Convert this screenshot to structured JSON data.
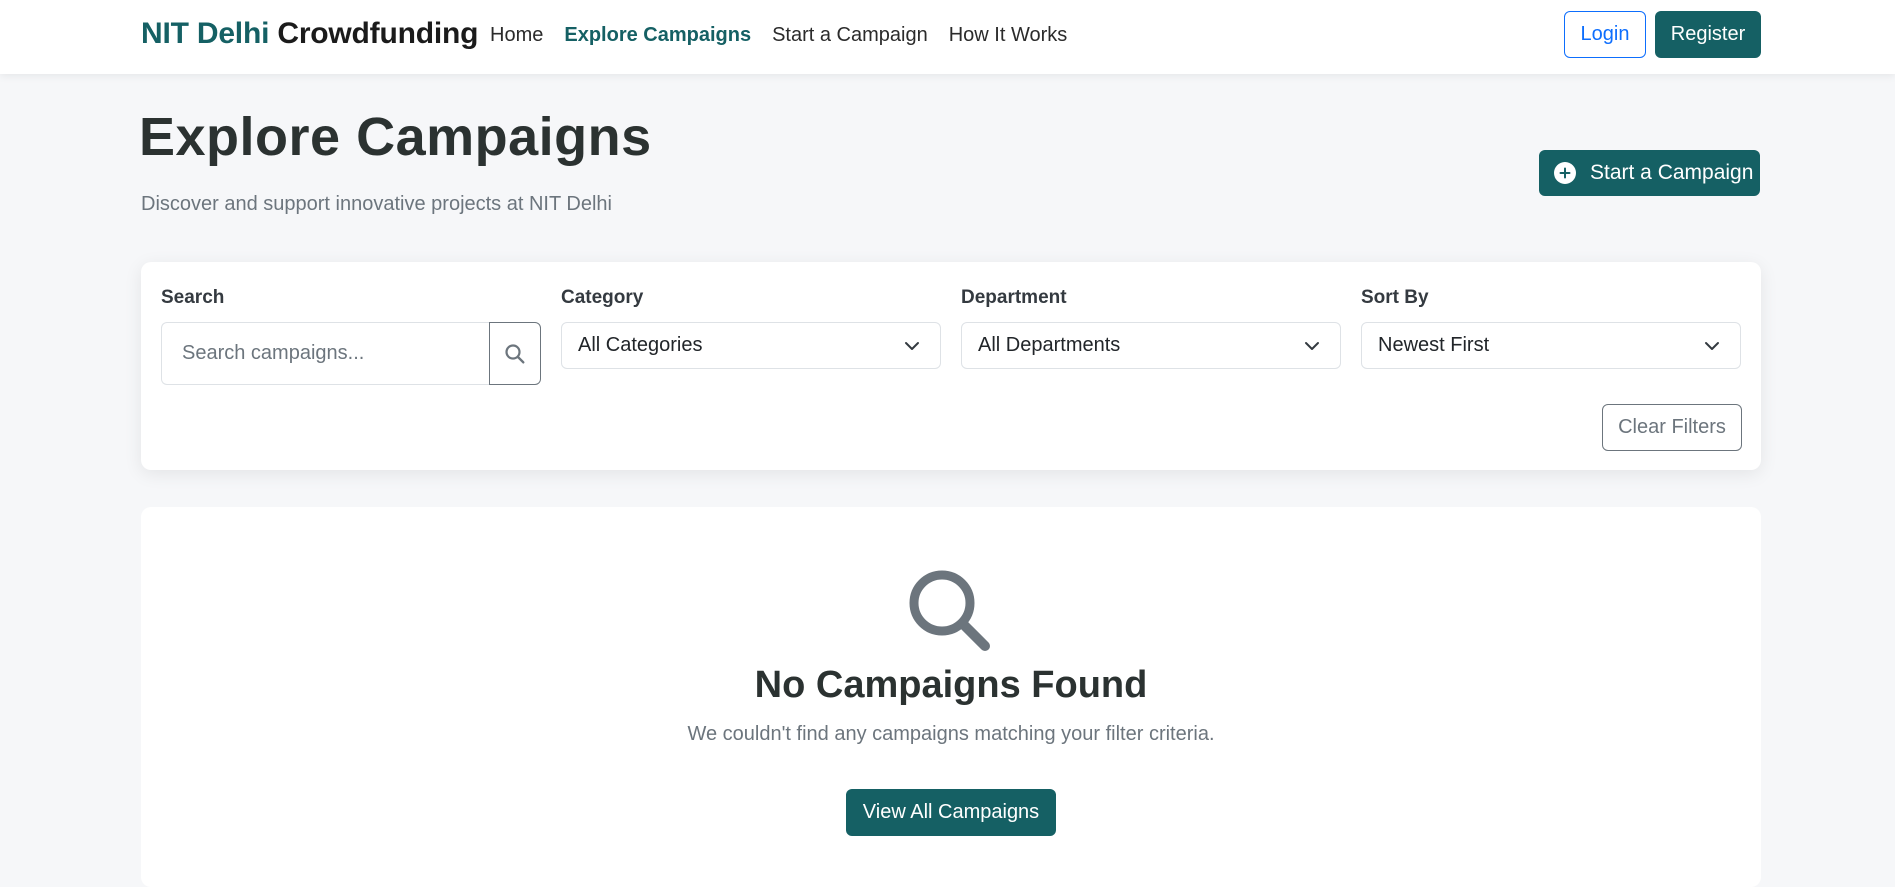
{
  "navbar": {
    "brand_accent": "NIT Delhi",
    "brand_rest": "Crowdfunding",
    "links": [
      {
        "label": "Home",
        "active": false
      },
      {
        "label": "Explore Campaigns",
        "active": true
      },
      {
        "label": "Start a Campaign",
        "active": false
      },
      {
        "label": "How It Works",
        "active": false
      }
    ],
    "login_label": "Login",
    "register_label": "Register"
  },
  "header": {
    "title": "Explore Campaigns",
    "subtitle": "Discover and support innovative projects at NIT Delhi",
    "start_button_label": "Start a Campaign"
  },
  "filters": {
    "search_label": "Search",
    "search_placeholder": "Search campaigns...",
    "search_value": "",
    "category_label": "Category",
    "category_value": "All Categories",
    "department_label": "Department",
    "department_value": "All Departments",
    "sort_label": "Sort By",
    "sort_value": "Newest First",
    "clear_label": "Clear Filters"
  },
  "results": {
    "empty_title": "No Campaigns Found",
    "empty_text": "We couldn't find any campaigns matching your filter criteria.",
    "view_all_label": "View All Campaigns"
  },
  "colors": {
    "brand": "#156064",
    "primary_blue": "#0d6efd",
    "muted": "#6c757d",
    "background": "#f6f7f9"
  },
  "icons": {
    "search_button": "search-icon",
    "start_button": "plus-circle-icon",
    "select_chevron": "chevron-down-icon",
    "empty_state": "magnifying-glass-icon"
  }
}
